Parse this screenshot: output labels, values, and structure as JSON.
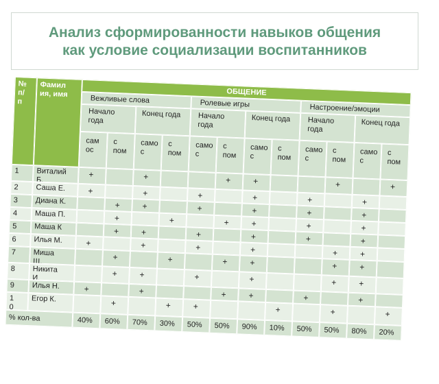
{
  "title": "Анализ сформированности навыков общения\nкак условие социализации воспитанников",
  "header": {
    "num": "№\nп/\nп",
    "name": "Фамил\nия, имя",
    "communication": "ОБЩЕНИЕ",
    "groups": [
      "Вежливые слова",
      "Ролевые игры",
      "Настроение/эмоции"
    ],
    "start": "Начало\nгода",
    "end": "Конец года",
    "self": [
      "сам\nос",
      "само\nс",
      "само\nс",
      "само\nс",
      "само\nс",
      "само\nс"
    ],
    "with": "с\nпом"
  },
  "rows": [
    {
      "num": "1",
      "name": "Виталий\nБ.",
      "marks": [
        "+",
        "",
        "+",
        "",
        "",
        "+",
        "+",
        "",
        "",
        "+",
        "",
        "+"
      ]
    },
    {
      "num": "2",
      "name": "Саша Е.",
      "marks": [
        "+",
        "",
        "+",
        "",
        "+",
        "",
        "+",
        "",
        "+",
        "",
        "+",
        ""
      ]
    },
    {
      "num": "3",
      "name": "Диана К.",
      "marks": [
        "",
        "+",
        "+",
        "",
        "+",
        "",
        "+",
        "",
        "+",
        "",
        "+",
        ""
      ]
    },
    {
      "num": "4",
      "name": "Маша П.",
      "marks": [
        "",
        "+",
        "",
        "+",
        "",
        "+",
        "+",
        "",
        "+",
        "",
        "+",
        ""
      ]
    },
    {
      "num": "5",
      "name": "Маша К",
      "marks": [
        "",
        "+",
        "+",
        "",
        "+",
        "",
        "+",
        "",
        "+",
        "",
        "+",
        ""
      ]
    },
    {
      "num": "6",
      "name": "Илья М.",
      "marks": [
        "+",
        "",
        "+",
        "",
        "+",
        "",
        "+",
        "",
        "",
        "+",
        "+",
        ""
      ]
    },
    {
      "num": "7",
      "name": "Миша\nЩ.",
      "marks": [
        "",
        "+",
        "",
        "+",
        "",
        "+",
        "+",
        "",
        "",
        "+",
        "+",
        ""
      ]
    },
    {
      "num": "8",
      "name": "Никита\nИ.",
      "marks": [
        "",
        "+",
        "+",
        "",
        "+",
        "",
        "+",
        "",
        "",
        "+",
        "+",
        ""
      ]
    },
    {
      "num": "9",
      "name": "Илья Н.",
      "marks": [
        "+",
        "",
        "+",
        "",
        "",
        "+",
        "+",
        "",
        "+",
        "",
        "+",
        ""
      ]
    },
    {
      "num": "1\n0",
      "name": "Егор К.",
      "marks": [
        "",
        "+",
        "",
        "+",
        "+",
        "",
        "",
        "+",
        "",
        "+",
        "",
        "+"
      ]
    }
  ],
  "summary": {
    "label": "% кол-ва",
    "values": [
      "40%",
      "60%",
      "70%",
      "30%",
      "50%",
      "50%",
      "90%",
      "10%",
      "50%",
      "50%",
      "80%",
      "20%"
    ]
  },
  "colors": {
    "title": "#5f9a7c",
    "header": "#8ebc49",
    "cell": "#d4e3d1",
    "cell_alt": "#e8f0e6"
  }
}
